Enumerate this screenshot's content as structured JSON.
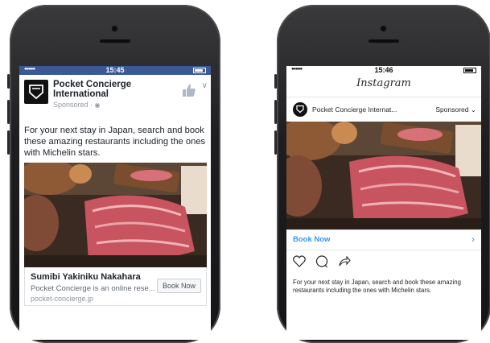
{
  "facebook": {
    "status_time": "15:45",
    "status_dots": "●●●●●",
    "page_name": "Pocket Concierge International",
    "sponsored": "Sponsored · ",
    "post_text": "For your next stay in Japan, search and book these amazing restaurants including the ones with Michelin stars.",
    "card_title": "Sumibi Yakiniku Nakahara",
    "card_description": "Pocket Concierge is an online rese...",
    "card_domain": "pocket-concierge.jp",
    "cta_label": "Book Now",
    "brand_color": "#3b5998"
  },
  "instagram": {
    "status_time": "15:46",
    "status_dots": "●●●●●",
    "logo_text": "Instagram",
    "account_name": "Pocket Concierge Internat...",
    "sponsored": "Sponsored",
    "cta_label": "Book Now",
    "caption": "For your next stay in Japan, search and book these amazing restaurants including the ones with Michelin stars.",
    "link_color": "#3897f0"
  }
}
